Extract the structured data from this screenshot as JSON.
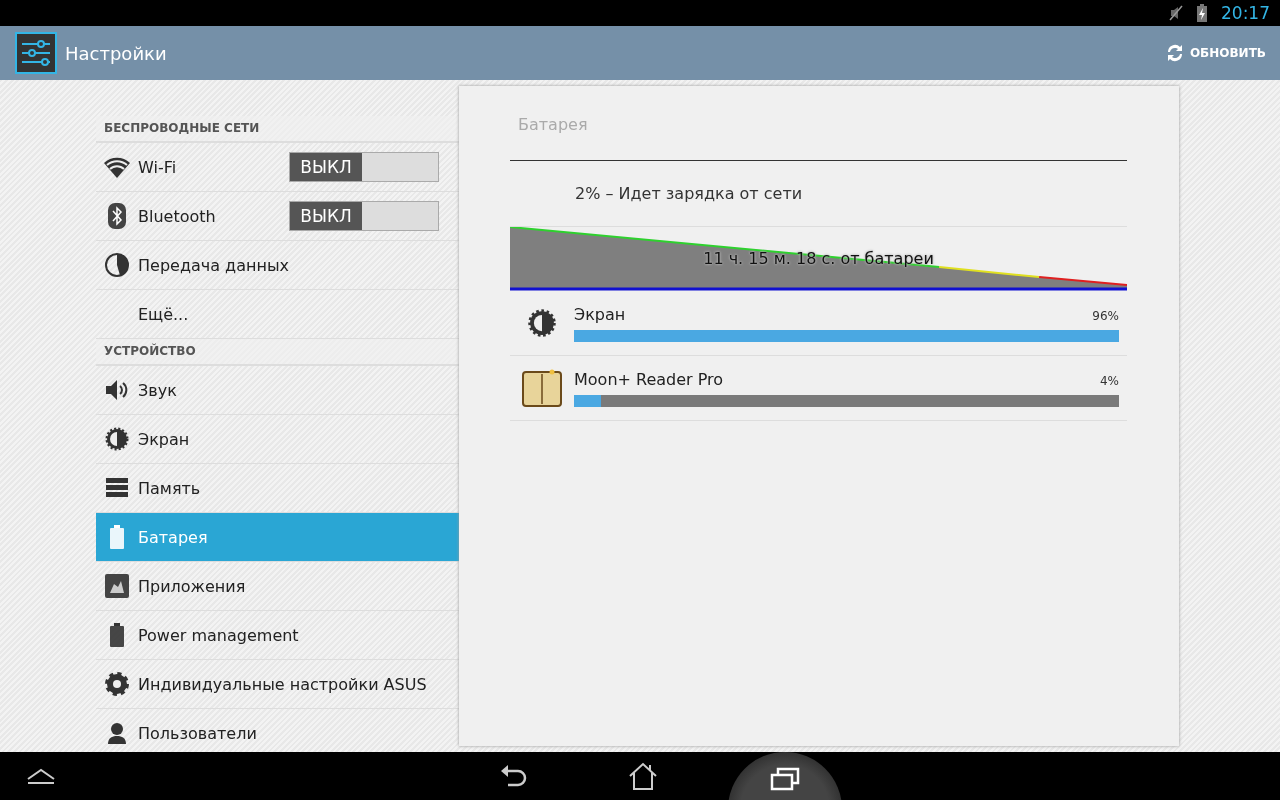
{
  "status_bar": {
    "time": "20:17"
  },
  "action_bar": {
    "title": "Настройки",
    "action": "ОБНОВИТЬ"
  },
  "sidebar": [
    {
      "kind": "header",
      "label": "БЕСПРОВОДНЫЕ СЕТИ"
    },
    {
      "kind": "toggle",
      "label": "Wi-Fi",
      "on": false,
      "switch_text": "ВЫКЛ",
      "selected": false
    },
    {
      "kind": "toggle",
      "label": "Bluetooth",
      "on": false,
      "switch_text": "ВЫКЛ",
      "selected": false
    },
    {
      "kind": "item",
      "label": "Передача данных",
      "selected": false
    },
    {
      "kind": "item",
      "label": "Ещё...",
      "selected": false
    },
    {
      "kind": "header",
      "label": "УСТРОЙСТВО"
    },
    {
      "kind": "item",
      "label": "Звук",
      "selected": false
    },
    {
      "kind": "item",
      "label": "Экран",
      "selected": false
    },
    {
      "kind": "item",
      "label": "Память",
      "selected": false
    },
    {
      "kind": "item",
      "label": "Батарея",
      "selected": true
    },
    {
      "kind": "item",
      "label": "Приложения",
      "selected": false
    },
    {
      "kind": "item",
      "label": "Power management",
      "selected": false
    },
    {
      "kind": "item",
      "label": "Индивидуальные настройки ASUS",
      "selected": false
    },
    {
      "kind": "item",
      "label": "Пользователи",
      "selected": false
    }
  ],
  "panel": {
    "title": "Батарея",
    "status": "2% – Идет зарядка от сети",
    "graph_label": "11 ч. 15 м. 18 с. от батареи",
    "usage": [
      {
        "name": "Экран",
        "percent": "96%",
        "level": 1.0
      },
      {
        "name": "Moon+ Reader Pro",
        "percent": "4%",
        "level": 0.05
      }
    ]
  }
}
